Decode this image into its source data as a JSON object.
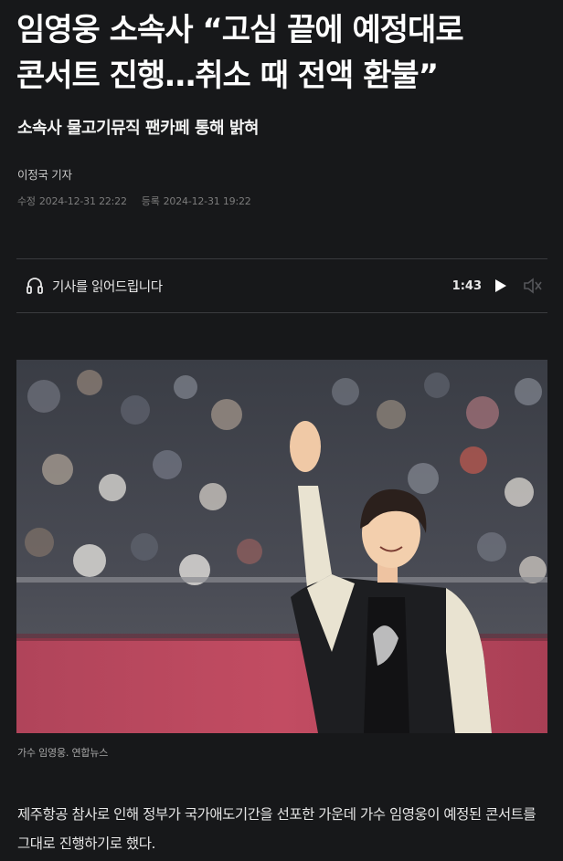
{
  "article": {
    "headline_line1": "임영웅 소속사 “고심 끝에 예정대로",
    "headline_line2": "콘서트 진행…취소 때 전액 환불”",
    "subtitle": "소속사 물고기뮤직 팬카페 통해 밝혀",
    "byline": "이정국 기자",
    "modified_label": "수정",
    "modified_date": "2024-12-31 22:22",
    "registered_label": "등록",
    "registered_date": "2024-12-31 19:22"
  },
  "audio_player": {
    "label": "기사를 읽어드립니다",
    "duration": "1:43",
    "icons": {
      "headphones": "headphones-icon",
      "play": "play-icon",
      "volume": "volume-icon"
    }
  },
  "photo": {
    "caption": "가수 임영웅. 연합뉴스"
  },
  "body": {
    "paragraph1": "제주항공 참사로 인해 정부가 국가애도기간을 선포한 가운데 가수 임영웅이 예정된 콘서트를 그대로 진행하기로 했다."
  },
  "colors": {
    "background": "#17181a",
    "text": "#ffffff",
    "muted": "#7c7c7c",
    "divider": "#3a3b3e"
  }
}
